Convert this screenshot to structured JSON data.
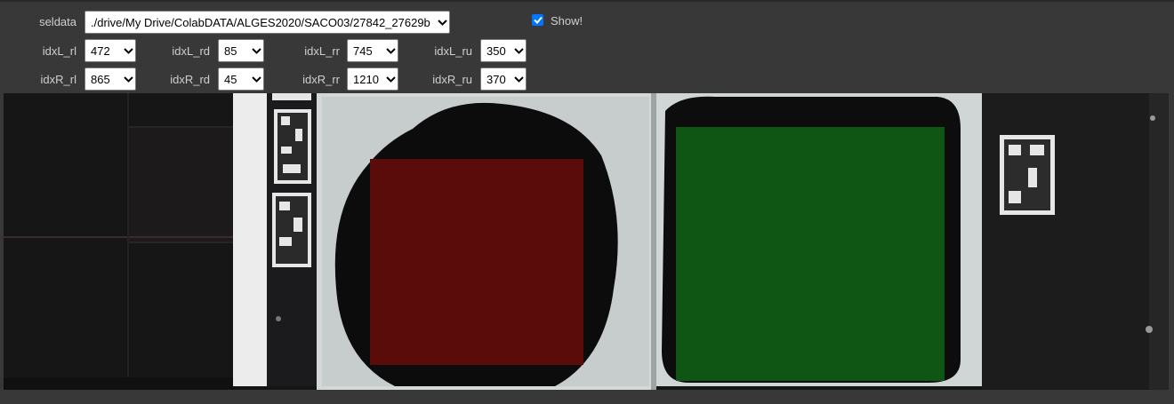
{
  "seldata": {
    "label": "seldata",
    "value": "./drive/My Drive/ColabDATA/ALGES2020/SACO03/27842_27629b"
  },
  "show": {
    "label": "Show!",
    "checked": true
  },
  "left_row": [
    {
      "label": "idxL_rl",
      "value": "472"
    },
    {
      "label": "idxL_rd",
      "value": "85"
    },
    {
      "label": "idxL_rr",
      "value": "745"
    },
    {
      "label": "idxL_ru",
      "value": "350"
    }
  ],
  "right_row": [
    {
      "label": "idxR_rl",
      "value": "865"
    },
    {
      "label": "idxR_rd",
      "value": "45"
    },
    {
      "label": "idxR_rr",
      "value": "1210"
    },
    {
      "label": "idxR_ru",
      "value": "370"
    }
  ],
  "image": {
    "left_roi_color": "#5a0c0a",
    "right_roi_color": "#0f5514"
  }
}
